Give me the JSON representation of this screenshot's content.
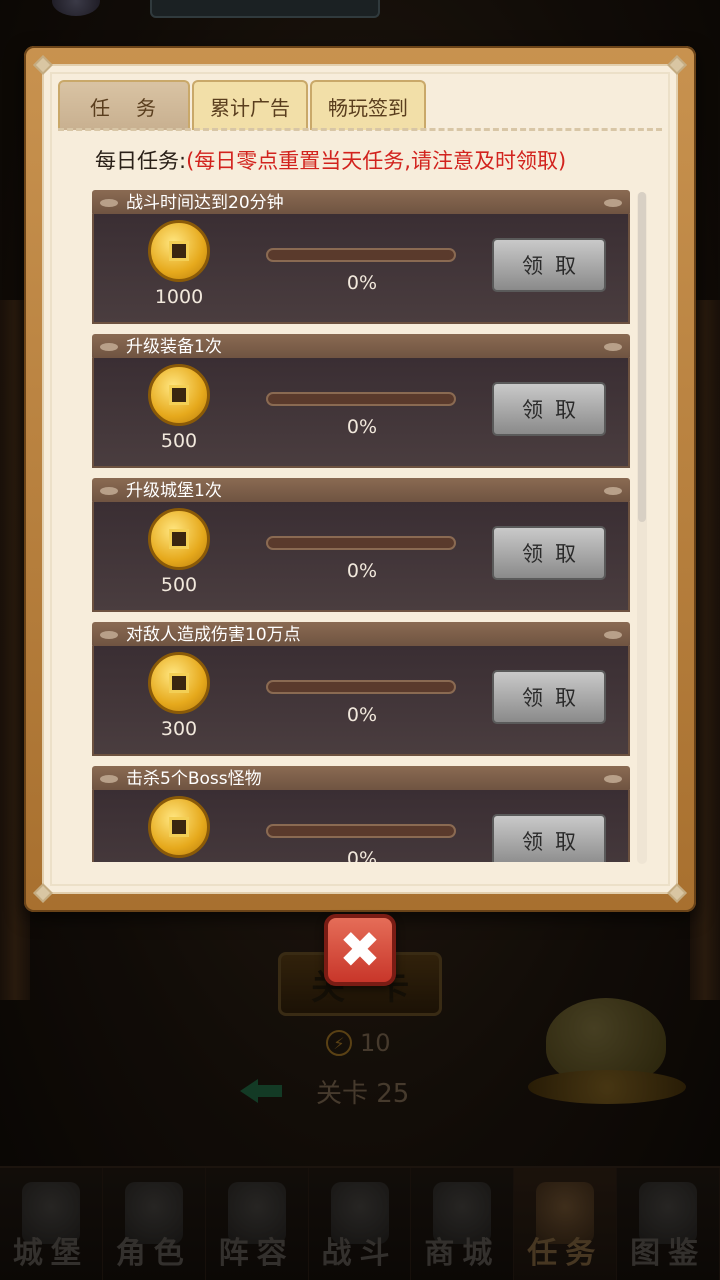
{
  "tabs": [
    {
      "label": "任务",
      "active": true
    },
    {
      "label": "累计广告",
      "active": false
    },
    {
      "label": "畅玩签到",
      "active": false
    }
  ],
  "subtitle": {
    "lead": "每日任务:",
    "note": "(每日零点重置当天任务,请注意及时领取)"
  },
  "tasks": [
    {
      "title": "战斗时间达到20分钟",
      "reward": "1000",
      "progress_label": "0%",
      "progress": 0,
      "button": "领取"
    },
    {
      "title": "升级装备1次",
      "reward": "500",
      "progress_label": "0%",
      "progress": 0,
      "button": "领取"
    },
    {
      "title": "升级城堡1次",
      "reward": "500",
      "progress_label": "0%",
      "progress": 0,
      "button": "领取"
    },
    {
      "title": "对敌人造成伤害10万点",
      "reward": "300",
      "progress_label": "0%",
      "progress": 0,
      "button": "领取"
    },
    {
      "title": "击杀5个Boss怪物",
      "reward": "",
      "progress_label": "0%",
      "progress": 0,
      "button": "领取"
    }
  ],
  "close_icon": "✖",
  "background": {
    "stage_button": "关卡",
    "energy": "10",
    "stage_label": "关卡 25"
  },
  "bottom_nav": [
    {
      "label": "城堡",
      "icon": "castle-icon"
    },
    {
      "label": "角色",
      "icon": "character-icon"
    },
    {
      "label": "阵容",
      "icon": "lineup-icon"
    },
    {
      "label": "战斗",
      "icon": "battle-icon"
    },
    {
      "label": "商城",
      "icon": "shop-icon"
    },
    {
      "label": "任务",
      "icon": "quest-scroll-icon",
      "active": true
    },
    {
      "label": "图鉴",
      "icon": "codex-icon"
    }
  ],
  "colors": {
    "note_red": "#d2231e",
    "panel_frame": "#b37a38",
    "panel_bg": "#f7eddb",
    "close_red": "#d5453a"
  }
}
